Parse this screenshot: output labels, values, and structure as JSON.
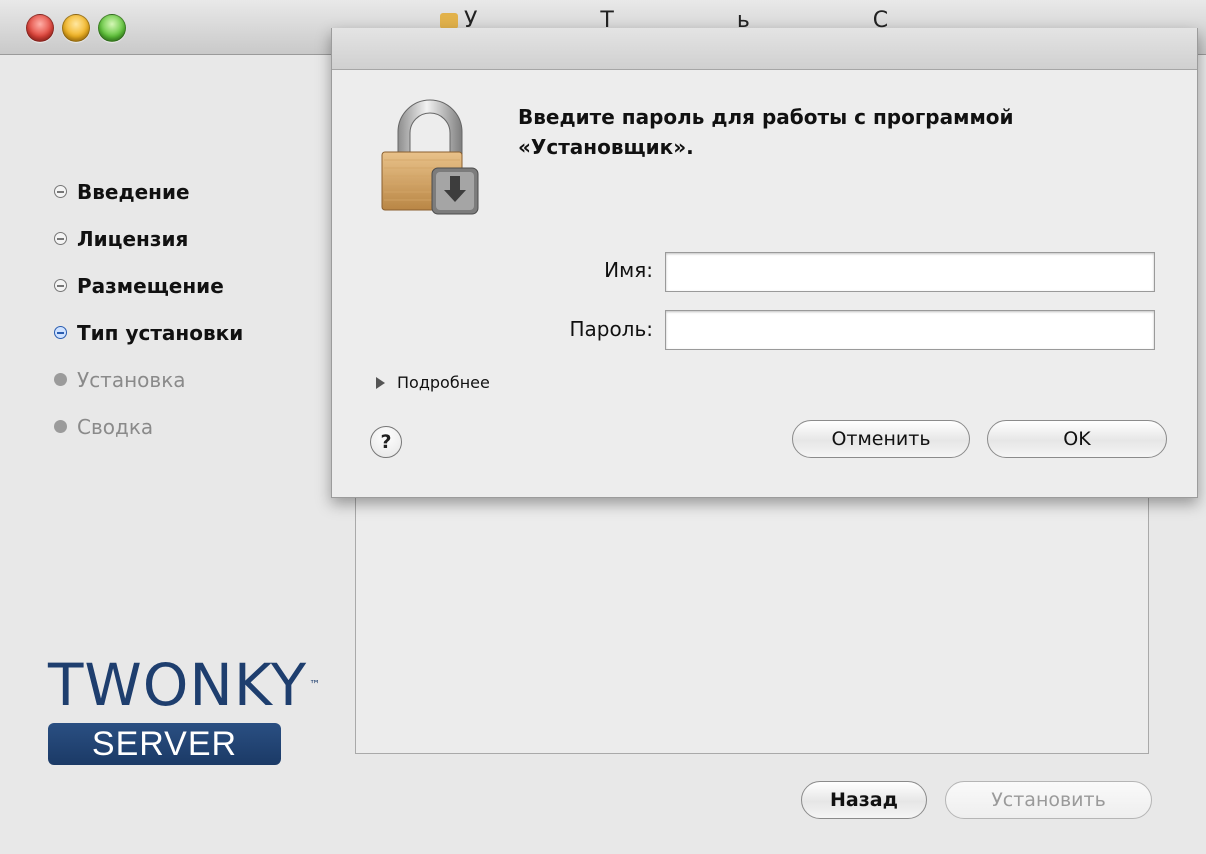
{
  "window": {
    "title_fragment": "У         Т      ь С"
  },
  "sidebar": {
    "steps": [
      {
        "label": "Введение",
        "state": "done"
      },
      {
        "label": "Лицензия",
        "state": "done"
      },
      {
        "label": "Размещение",
        "state": "done"
      },
      {
        "label": "Тип установки",
        "state": "current"
      },
      {
        "label": "Установка",
        "state": "pending"
      },
      {
        "label": "Сводка",
        "state": "pending"
      }
    ]
  },
  "logo": {
    "word": "TWONKY",
    "tm": "™",
    "badge": "SERVER"
  },
  "footer": {
    "back_label": "Назад",
    "install_label": "Установить"
  },
  "dialog": {
    "message": "Введите пароль для работы с программой «Установщик».",
    "name_label": "Имя:",
    "name_value": "",
    "password_label": "Пароль:",
    "password_value": "",
    "details_label": "Подробнее",
    "help_label": "?",
    "cancel_label": "Отменить",
    "ok_label": "OK"
  },
  "colors": {
    "accent_current_step": "#2a5db0",
    "logo_blue": "#1e3e6e"
  }
}
